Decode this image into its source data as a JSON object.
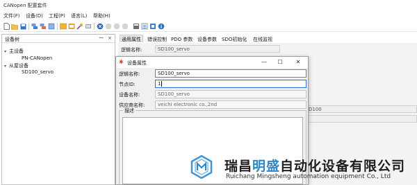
{
  "window": {
    "title": "CANopen 配置套件"
  },
  "menu": [
    {
      "label": "文件(F)"
    },
    {
      "label": "设备(D)"
    },
    {
      "label": "工程(P)"
    },
    {
      "label": "语言(L)"
    },
    {
      "label": "帮助(H)"
    }
  ],
  "toolbar": {
    "icons": [
      "new-file-icon",
      "open-folder-icon",
      "save-icon",
      "add-device-icon",
      "remove-device-icon",
      "import-icon",
      "export-icon",
      "settings-icon",
      "tools-icon",
      "connect-icon",
      "start-icon",
      "stop-icon",
      "monitor-icon",
      "download-icon",
      "info-icon"
    ]
  },
  "device_tree": {
    "title": "设备树",
    "controls": {
      "pin": "ꟷ",
      "close": "×"
    },
    "nodes": [
      {
        "label": "主设备",
        "expander": "▾"
      },
      {
        "label": "PN-CANopen"
      },
      {
        "label": "从屋设备",
        "expander": "▾"
      },
      {
        "label": "SD100_servo"
      }
    ]
  },
  "tabs": [
    {
      "label": "通用属性",
      "active": true
    },
    {
      "label": "错误控制"
    },
    {
      "label": "PDO 参数"
    },
    {
      "label": "设备参数"
    },
    {
      "label": "SDO初始化"
    },
    {
      "label": "在线监视"
    }
  ],
  "background_form": {
    "logic_name_label": "逻辑名称:",
    "logic_name_value": "SD100_servo",
    "partial_value": "D100"
  },
  "dialog": {
    "title": "设备属性",
    "controls": {
      "minimize": "—",
      "maximize": "☐",
      "close": "✕"
    },
    "fields": [
      {
        "label": "逻辑名称:",
        "value": "SD100_servo",
        "editable": true
      },
      {
        "label": "节点ID:",
        "value": "1",
        "editable": true,
        "focused": true
      },
      {
        "label": "设备名称:",
        "value": "SD100_servo",
        "editable": false
      },
      {
        "label": "供应商名称:",
        "value": "veichi electronic co.,2nd",
        "editable": false
      }
    ],
    "description_label": "描述"
  },
  "watermark": {
    "cn_pre": "瑞昌",
    "cn_highlight": "明盛",
    "cn_post": "自动化设备有限公司",
    "en": "Ruichang Mingsheng automation equipment Co., Ltd",
    "accent": "#2f86c9"
  }
}
